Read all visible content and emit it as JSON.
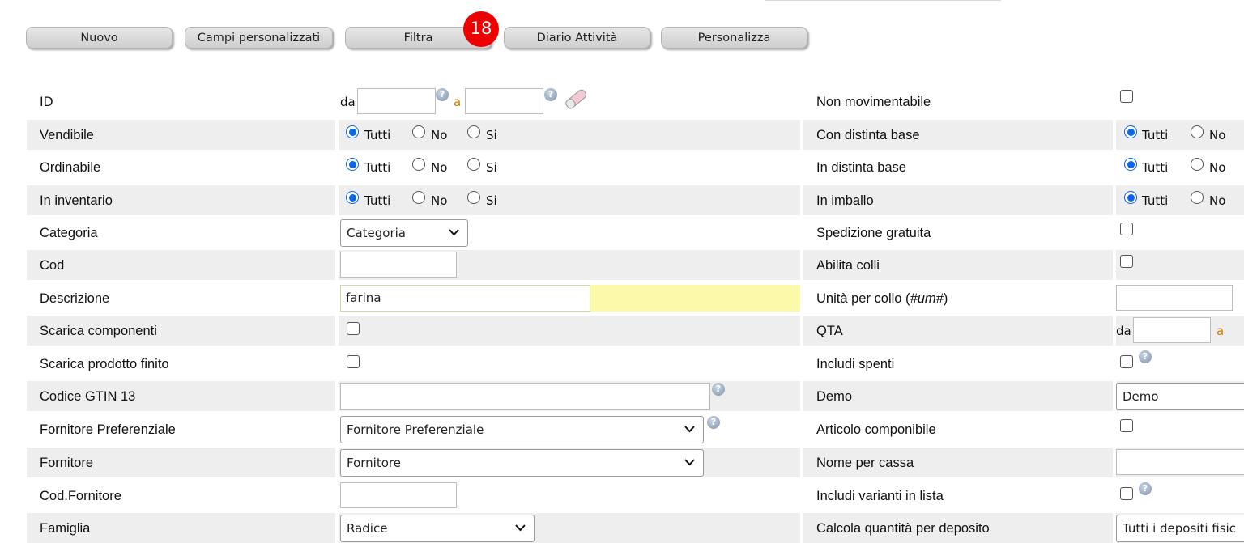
{
  "toolbar": {
    "nuovo": "Nuovo",
    "campi": "Campi personalizzati",
    "filtra": "Filtra",
    "badge": "18",
    "diario": "Diario Attività",
    "personalizza": "Personalizza"
  },
  "labels": {
    "id": "ID",
    "vendibile": "Vendibile",
    "ordinabile": "Ordinabile",
    "inventario": "In inventario",
    "categoria": "Categoria",
    "cod": "Cod",
    "descrizione": "Descrizione",
    "scarica_comp": "Scarica componenti",
    "scarica_prod": "Scarica prodotto finito",
    "gtin": "Codice GTIN 13",
    "fornitore_pref": "Fornitore Preferenziale",
    "fornitore": "Fornitore",
    "cod_fornitore": "Cod.Fornitore",
    "famiglia": "Famiglia",
    "non_mov": "Non movimentabile",
    "con_distinta": "Con distinta base",
    "in_distinta": "In distinta base",
    "imballo": "In imballo",
    "spedizione": "Spedizione gratuita",
    "colli": "Abilita colli",
    "unita_collo": "Unità per collo (",
    "unita_collo_em": "#um#",
    "unita_collo_end": ")",
    "qta": "QTA",
    "spenti": "Includi spenti",
    "demo": "Demo",
    "componibile": "Articolo componibile",
    "nome_cassa": "Nome per cassa",
    "varianti": "Includi varianti in lista",
    "calcola": "Calcola quantità per deposito"
  },
  "range": {
    "from": "da",
    "to": "a"
  },
  "radio": {
    "tutti": "Tutti",
    "no": "No",
    "si": "Si"
  },
  "fields": {
    "descrizione_value": "farina",
    "categoria_select": "Categoria",
    "fornitore_pref_select": "Fornitore Preferenziale",
    "fornitore_select": "Fornitore",
    "famiglia_select": "Radice",
    "demo_select": "Demo",
    "deposito_select": "Tutti i depositi fisic"
  },
  "icons": {
    "help": "?"
  }
}
